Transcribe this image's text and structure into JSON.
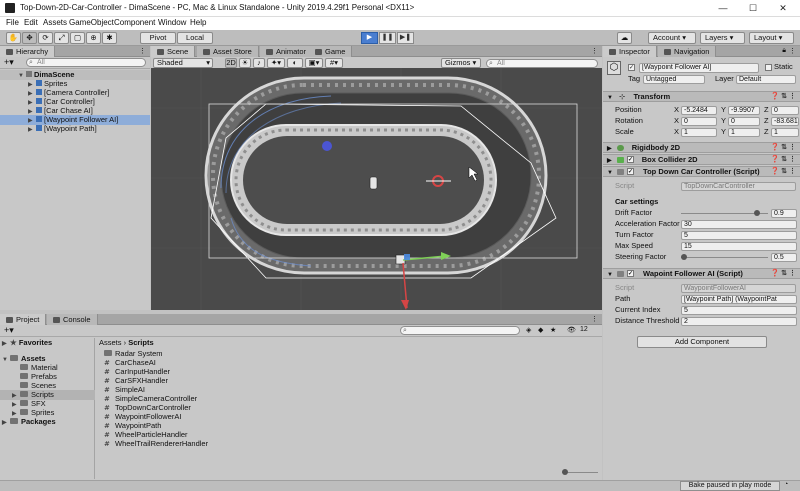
{
  "window": {
    "title": "Top-Down-2D-Car-Controller - DimaScene - PC, Mac & Linux Standalone - Unity 2019.4.29f1 Personal <DX11>",
    "minimize": "—",
    "maximize": "☐",
    "close": "✕"
  },
  "menu": [
    "File",
    "Edit",
    "Assets",
    "GameObject",
    "Component",
    "Window",
    "Help"
  ],
  "toolbar": {
    "pivot": "Pivot",
    "local": "Local",
    "play": "▶",
    "pause": "❚❚",
    "step": "▶❚",
    "account": "Account",
    "layers": "Layers",
    "layout": "Layout"
  },
  "hierarchy": {
    "tab": "Hierarchy",
    "search_placeholder": "All",
    "scene": "DimaScene",
    "items": [
      "Sprites",
      "[Camera Controller]",
      "[Car Controller]",
      "[Car Chase AI]",
      "[Waypoint Follower AI]",
      "[Waypoint Path]"
    ]
  },
  "scene": {
    "tabs": [
      "Scene",
      "Asset Store",
      "Animator",
      "Game"
    ],
    "shading": "Shaded",
    "mode_2d": "2D",
    "gizmos": "Gizmos",
    "search_placeholder": "All"
  },
  "inspector": {
    "tabs": [
      "Inspector",
      "Navigation"
    ],
    "object_name": "[Waypoint Follower AI]",
    "static_label": "Static",
    "tag_label": "Tag",
    "tag_value": "Untagged",
    "layer_label": "Layer",
    "layer_value": "Default",
    "transform": {
      "title": "Transform",
      "position": {
        "label": "Position",
        "x": "-5.2484",
        "y": "-9.9907",
        "z": "0"
      },
      "rotation": {
        "label": "Rotation",
        "x": "0",
        "y": "0",
        "z": "-83.681"
      },
      "scale": {
        "label": "Scale",
        "x": "1",
        "y": "1",
        "z": "1"
      }
    },
    "rigidbody": "Rigidbody 2D",
    "collider": "Box Collider 2D",
    "car_controller": {
      "title": "Top Down Car Controller (Script)",
      "script_label": "Script",
      "script_value": "TopDownCarController",
      "section": "Car settings",
      "fields": [
        {
          "label": "Drift Factor",
          "value": "0.9",
          "slider": 0.9
        },
        {
          "label": "Acceleration Factor",
          "value": "30"
        },
        {
          "label": "Turn Factor",
          "value": "5"
        },
        {
          "label": "Max Speed",
          "value": "15"
        },
        {
          "label": "Steering Factor",
          "value": "0.5",
          "slider": 0.0
        }
      ]
    },
    "waypoint_follower": {
      "title": "Wapoint Follower AI (Script)",
      "script_label": "Script",
      "script_value": "WaypointFollowerAI",
      "path_label": "Path",
      "path_value": "[Waypoint Path] (WaypointPat",
      "index_label": "Current Index",
      "index_value": "5",
      "threshold_label": "Distance Threshold",
      "threshold_value": "2"
    },
    "add_component": "Add Component"
  },
  "project": {
    "tabs": [
      "Project",
      "Console"
    ],
    "favorites": "Favorites",
    "assets": "Assets",
    "asset_folders": [
      "Material",
      "Prefabs",
      "Scenes",
      "Scripts",
      "SFX",
      "Sprites"
    ],
    "packages": "Packages",
    "breadcrumb_root": "Assets",
    "breadcrumb_sep": "›",
    "breadcrumb_current": "Scripts",
    "count": "12",
    "folder_item": "Radar System",
    "scripts": [
      "CarChaseAI",
      "CarInputHandler",
      "CarSFXHandler",
      "SimpleAI",
      "SimpleCameraController",
      "TopDownCarController",
      "WaypointFollowerAI",
      "WaypointPath",
      "WheelParticleHandler",
      "WheelTrailRendererHandler"
    ]
  },
  "status": {
    "bake": "Bake paused in play mode"
  }
}
